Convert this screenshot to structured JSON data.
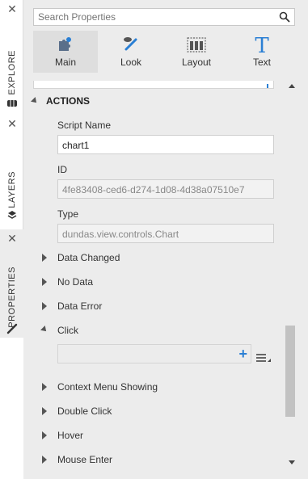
{
  "side_tabs": [
    {
      "label": "EXPLORE",
      "icon": "database-icon"
    },
    {
      "label": "LAYERS",
      "icon": "layers-icon"
    },
    {
      "label": "PROPERTIES",
      "icon": "brush-icon"
    }
  ],
  "search": {
    "placeholder": "Search Properties"
  },
  "tabs": [
    {
      "label": "Main",
      "icon": "puzzle-icon"
    },
    {
      "label": "Look",
      "icon": "paint-brush-icon"
    },
    {
      "label": "Layout",
      "icon": "layout-grid-icon"
    },
    {
      "label": "Text",
      "icon": "text-t-icon"
    }
  ],
  "section": {
    "title": "ACTIONS"
  },
  "fields": {
    "script_name": {
      "label": "Script Name",
      "value": "chart1"
    },
    "id": {
      "label": "ID",
      "value": "4fe83408-ced6-d274-1d08-4d38a07510e7"
    },
    "type": {
      "label": "Type",
      "value": "dundas.view.controls.Chart"
    }
  },
  "events_top": [
    "Data Changed",
    "No Data",
    "Data Error"
  ],
  "click": {
    "label": "Click",
    "add_icon": "+"
  },
  "events_bottom": [
    "Context Menu Showing",
    "Double Click",
    "Hover",
    "Mouse Enter"
  ],
  "colors": {
    "accent": "#2a7fd4",
    "panel_bg": "#ececec"
  }
}
